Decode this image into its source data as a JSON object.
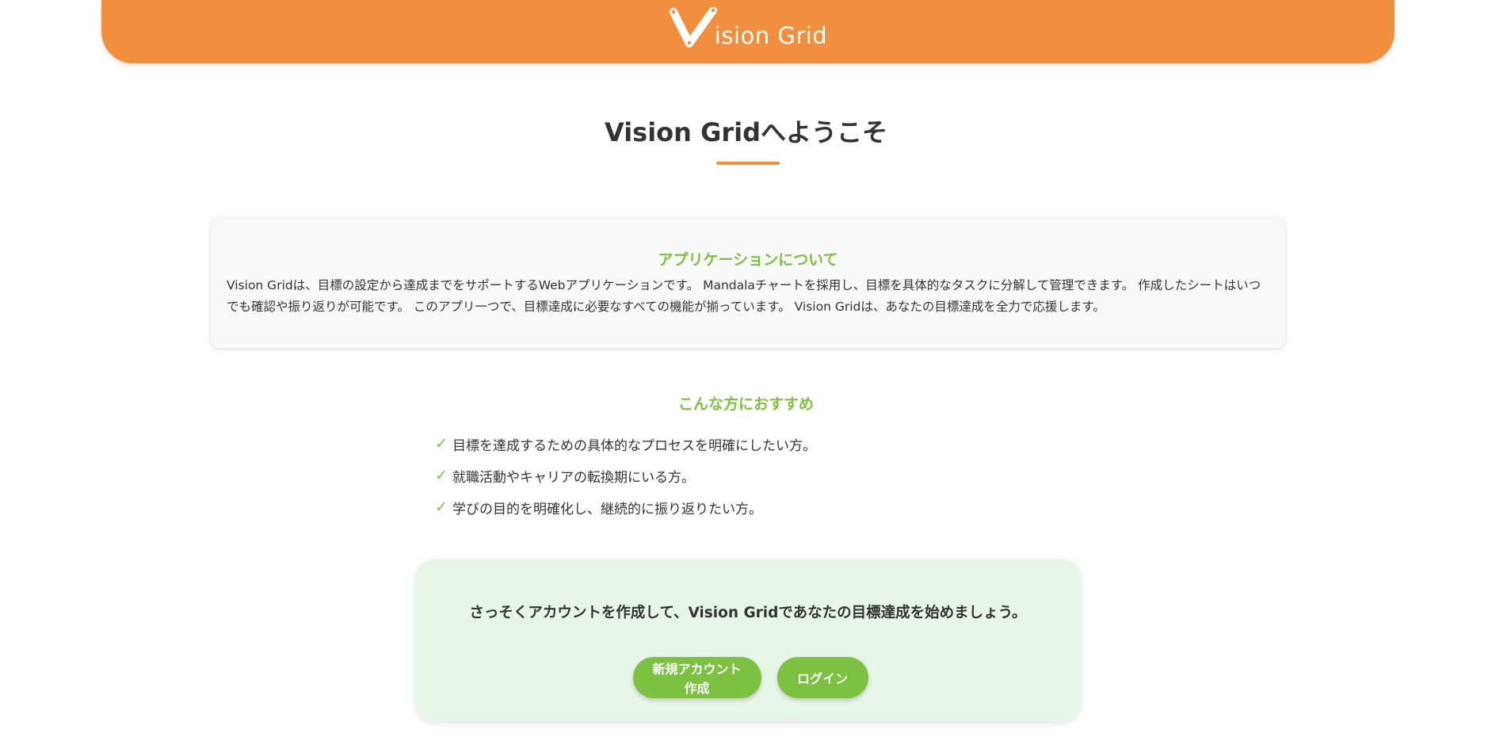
{
  "header": {
    "logo_text": "ision Grid"
  },
  "title": "Vision Gridへようこそ",
  "about": {
    "heading": "アプリケーションについて",
    "body": "Vision Gridは、目標の設定から達成までをサポートするWebアプリケーションです。 Mandalaチャートを採用し、目標を具体的なタスクに分解して管理できます。 作成したシートはいつでも確認や振り返りが可能です。 このアプリ一つで、目標達成に必要なすべての機能が揃っています。 Vision Gridは、あなたの目標達成を全力で応援します。"
  },
  "recommend": {
    "heading": "こんな方におすすめ",
    "check": "✓",
    "items": [
      "目標を達成するための具体的なプロセスを明確にしたい方。",
      "就職活動やキャリアの転換期にいる方。",
      "学びの目的を明確化し、継続的に振り返りたい方。"
    ]
  },
  "cta": {
    "text": "さっそくアカウントを作成して、Vision Gridであなたの目標達成を始めましょう。",
    "register_label": "新規アカウント作成",
    "login_label": "ログイン"
  },
  "colors": {
    "brand_orange": "#f28f3e",
    "accent_green": "#7cc142",
    "cta_background": "#e8f5e9"
  }
}
